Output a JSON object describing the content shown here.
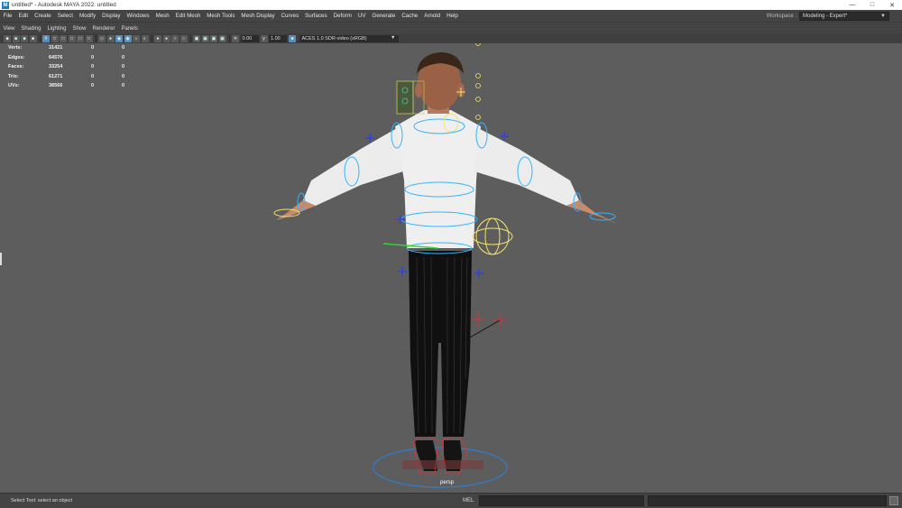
{
  "window": {
    "title": "untitled* - Autodesk MAYA 2022: untitled",
    "app_icon": "M",
    "controls": [
      "minimize-icon",
      "maximize-icon",
      "close-icon"
    ]
  },
  "menubar": {
    "items": [
      "File",
      "Edit",
      "Create",
      "Select",
      "Modify",
      "Display",
      "Windows",
      "Mesh",
      "Edit Mesh",
      "Mesh Tools",
      "Mesh Display",
      "Curves",
      "Surfaces",
      "Deform",
      "UV",
      "Generate",
      "Cache",
      "Arnold",
      "Help"
    ],
    "workspace_label": "Workspace :",
    "workspace_value": "Modeling - Expert*"
  },
  "panel_menu": {
    "items": [
      "View",
      "Shading",
      "Lighting",
      "Show",
      "Renderer",
      "Panels"
    ]
  },
  "viewport_toolbar": {
    "exposure": "0.00",
    "gamma": "1.00",
    "view_transform": "ACES 1.0 SDR-video (sRGB)"
  },
  "hud": {
    "rows": [
      {
        "label": "Verts:",
        "values": [
          "31421",
          "0",
          "0"
        ]
      },
      {
        "label": "Edges:",
        "values": [
          "64576",
          "0",
          "0"
        ]
      },
      {
        "label": "Faces:",
        "values": [
          "33254",
          "0",
          "0"
        ]
      },
      {
        "label": "Tris:",
        "values": [
          "61271",
          "0",
          "0"
        ]
      },
      {
        "label": "UVs:",
        "values": [
          "38566",
          "0",
          "0"
        ]
      }
    ]
  },
  "viewport": {
    "camera": "persp",
    "background": "#5d5d5d"
  },
  "statusbar": {
    "help_text": "Select Tool: select an object",
    "mel_label": "MEL"
  },
  "colors": {
    "ui_dark": "#444444",
    "viewport_bg": "#5d5d5d",
    "control_blue": "#33b5ff",
    "control_yellow": "#f2e46a",
    "ik_red": "#e03030"
  }
}
